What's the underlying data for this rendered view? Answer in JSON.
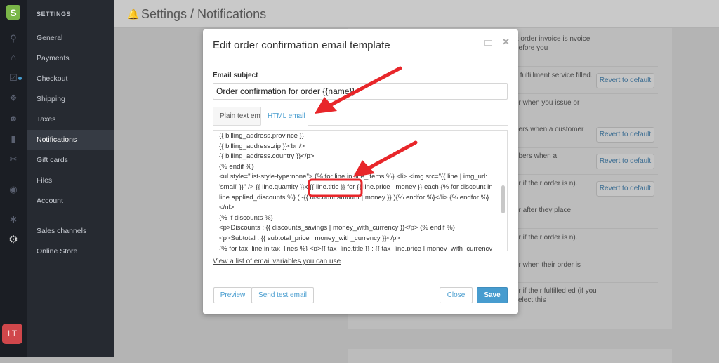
{
  "app": {
    "logo_letter": "S",
    "avatar_initials": "LT"
  },
  "iconbar": [
    "search-icon",
    "home-icon",
    "orders-icon",
    "products-icon",
    "customers-icon",
    "reports-icon",
    "discounts-icon",
    "online-store-icon",
    "apps-icon",
    "settings-icon"
  ],
  "sidebar": {
    "heading": "SETTINGS",
    "items": [
      {
        "label": "General"
      },
      {
        "label": "Payments"
      },
      {
        "label": "Checkout"
      },
      {
        "label": "Shipping"
      },
      {
        "label": "Taxes"
      },
      {
        "label": "Notifications",
        "active": true
      },
      {
        "label": "Gift cards"
      },
      {
        "label": "Files"
      },
      {
        "label": "Account"
      },
      {
        "label": "Sales channels"
      },
      {
        "label": "Online Store"
      }
    ]
  },
  "header": {
    "breadcrumb": "Settings / Notifications"
  },
  "notifications": [
    {
      "text": "ft order invoice is nvoice before you",
      "revert": false
    },
    {
      "text": "y fulfillment service filled.",
      "revert": true
    },
    {
      "text": "er when you issue or",
      "revert": false
    },
    {
      "text": "bers when a customer",
      "revert": true
    },
    {
      "text": "ribers when a",
      "revert": true
    },
    {
      "text": "er if their order is n).",
      "revert": true
    },
    {
      "text": "er after they place",
      "revert": false
    },
    {
      "text": "er if their order is n).",
      "revert": false
    },
    {
      "text": "er when their order is",
      "revert": false
    },
    {
      "text": "er if their fulfilled ed (if you select this",
      "revert": false
    }
  ],
  "revert_label": "Revert to default",
  "modal": {
    "title": "Edit order confirmation email template",
    "subject_label": "Email subject",
    "subject_value": "Order confirmation for order {{name}}",
    "tabs": [
      {
        "label": "Plain text email",
        "active": false
      },
      {
        "label": "HTML email",
        "active": true
      }
    ],
    "code_lines": [
      "{{ billing_address.province }}",
      "{{ billing_address.zip }}<br />",
      "{{ billing_address.country }}</p>",
      "{% endif %}",
      "<ul style=\"list-style-type:none\"> {% for line in line_items %} <li> <img src=\"{{ line | img_url: 'small' }}\" /> {{ line.quantity }}x {{ line.title }} for {{ line.price | money }} each {% for discount in line.applied_discounts %} ( -{{ discount.amount | money }} ){% endfor %}</li> {% endfor %}",
      "</ul>",
      "{% if discounts %}",
      "<p>Discounts : {{ discounts_savings | money_with_currency }}</p> {% endif %}",
      "<p>Subtotal : {{ subtotal_price | money_with_currency }}</p>",
      "{% for tax_line in tax_lines %} <p>{{ tax_line.title }} : {{ tax_line.price | money_with_currency"
    ],
    "variables_link": "View a list of email variables you can use",
    "buttons": {
      "preview": "Preview",
      "send_test": "Send test email",
      "close": "Close",
      "save": "Save"
    }
  },
  "colors": {
    "accent": "#479ccf",
    "annotation": "#e8262a",
    "avatar": "#d0474b"
  }
}
